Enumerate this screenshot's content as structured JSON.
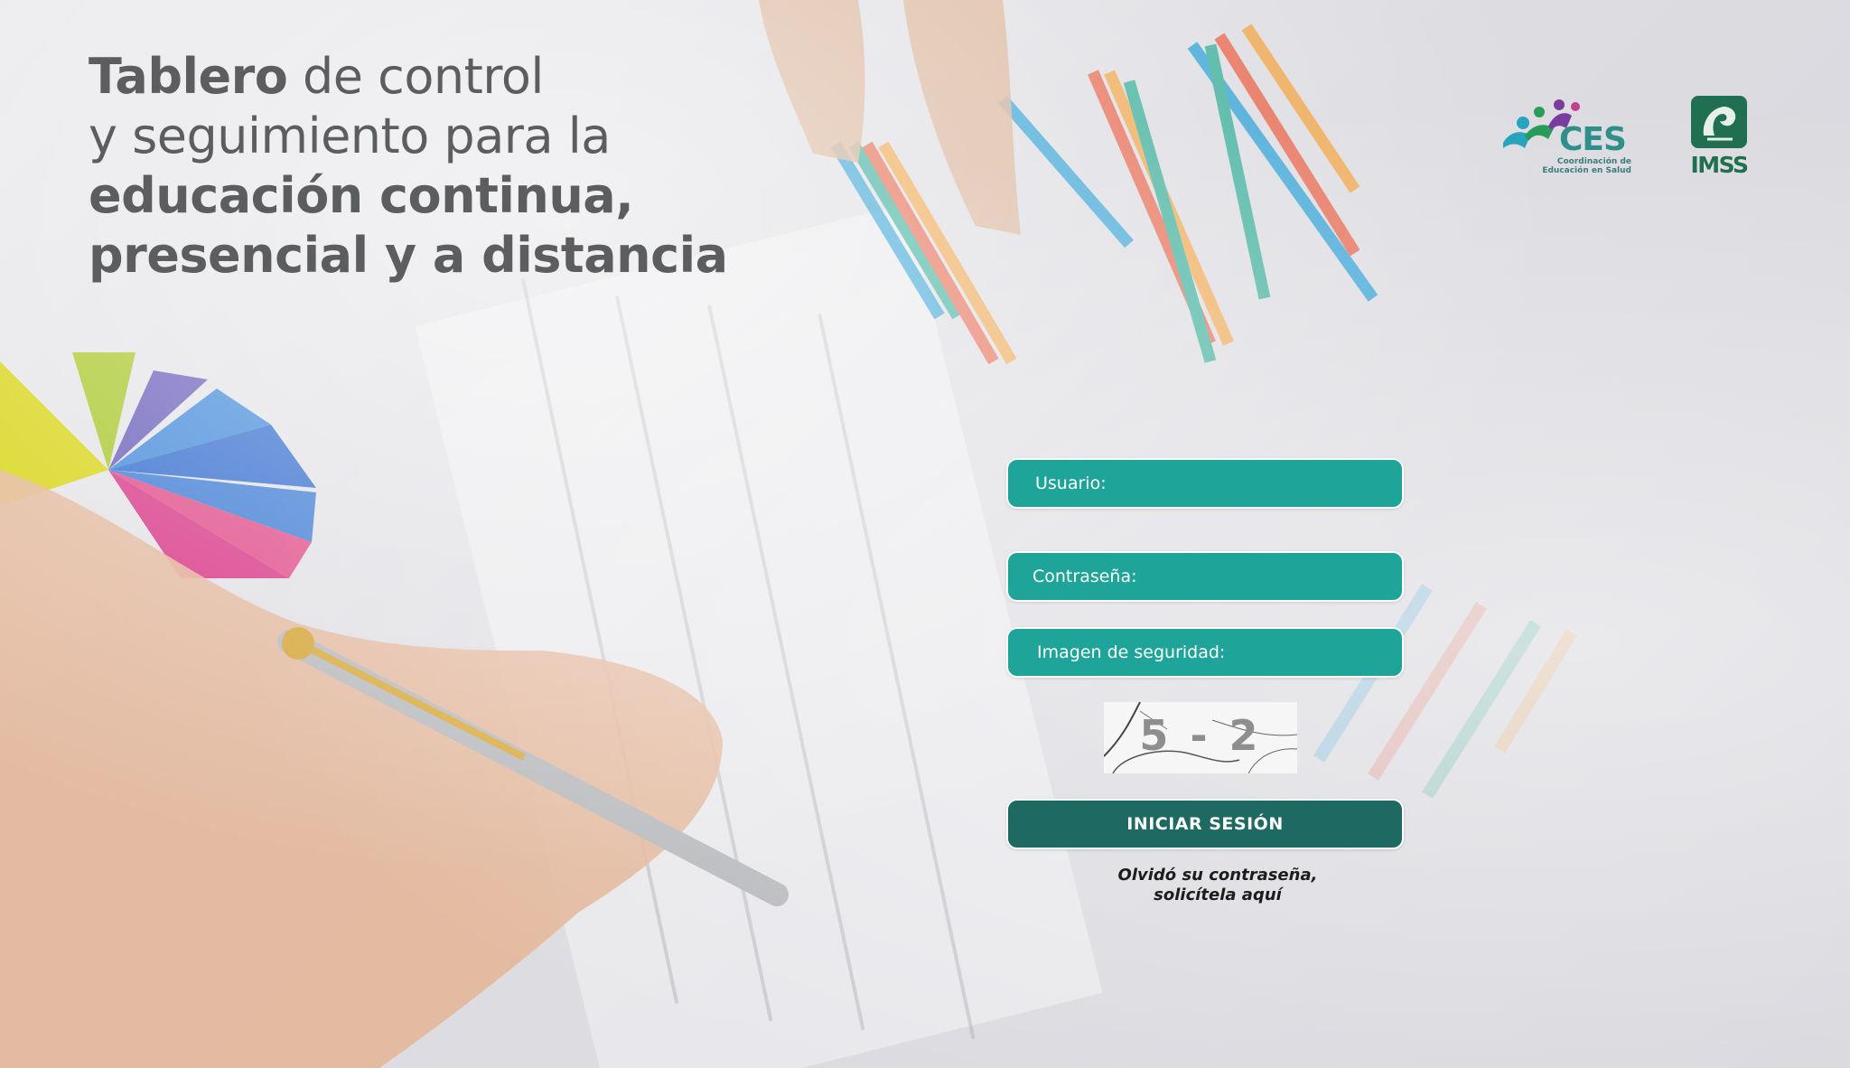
{
  "headline": {
    "line1_bold": "Tablero",
    "line1_light": " de control",
    "line2": "y seguimiento para la",
    "line3": "educación continua,",
    "line4": "presencial y a distancia"
  },
  "logos": {
    "ces_name": "CES",
    "ces_subtitle_1": "Coordinación de",
    "ces_subtitle_2": "Educación en Salud",
    "imss_name": "IMSS"
  },
  "form": {
    "user_label": "Usuario:",
    "user_value": "",
    "password_label": "Contraseña:",
    "password_value": "",
    "captcha_label": "Imagen de seguridad:",
    "captcha_value": "",
    "captcha_text": "5 - 2",
    "submit_label": "INICIAR SESIÓN",
    "forgot_line1": "Olvidó su contraseña,",
    "forgot_line2": "solicítela aquí"
  },
  "colors": {
    "field_teal": "#1fa49a",
    "button_dark_teal": "#1e6a62",
    "headline_gray": "#5b5d5f"
  }
}
